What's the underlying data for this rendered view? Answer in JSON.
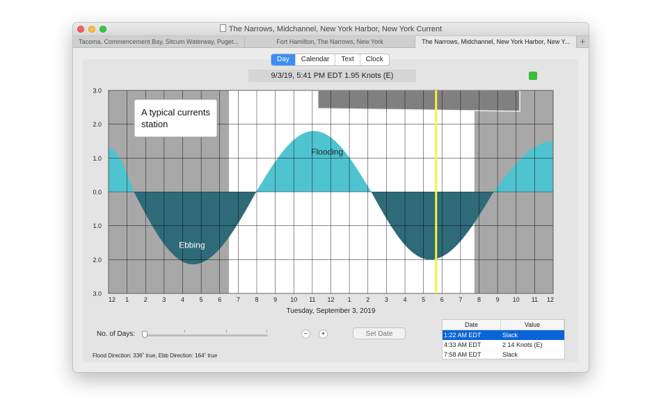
{
  "window": {
    "title": "The Narrows, Midchannel, New York Harbor, New York Current",
    "tabs": [
      {
        "label": "Tacoma, Commencement Bay, Sitcum Waterway, Puget..."
      },
      {
        "label": "Fort Hamilton, The Narrows, New York"
      },
      {
        "label": "The Narrows, Midchannel, New York Harbor, New Y..."
      }
    ],
    "add_tab_label": "+"
  },
  "view_modes": [
    "Day",
    "Calendar",
    "Text",
    "Clock"
  ],
  "selected_view": "Day",
  "readout": "9/3/19, 5:41 PM EDT 1.95 Knots (E)",
  "status_color": "#3bbf3b",
  "chart_data": {
    "type": "area",
    "x_tick_labels": [
      "12",
      "1",
      "2",
      "3",
      "4",
      "5",
      "6",
      "7",
      "8",
      "9",
      "10",
      "11",
      "12",
      "1",
      "2",
      "3",
      "4",
      "5",
      "6",
      "7",
      "8",
      "9",
      "10",
      "11",
      "12"
    ],
    "y_tick_labels": [
      "3.0",
      "2.0",
      "1.0",
      "0.0",
      "1.0",
      "2.0",
      "3.0"
    ],
    "ylim": [
      -3,
      3
    ],
    "xlim": [
      0,
      24
    ],
    "xlabel": "Tuesday, September 3, 2019",
    "series": [
      {
        "x": [
          0,
          1.37,
          4.55,
          7.97,
          11.08,
          14.18,
          17.35,
          20.78,
          24
        ],
        "y": [
          1.3,
          0,
          -2.14,
          0,
          1.8,
          0,
          -2.0,
          0,
          1.5
        ]
      }
    ],
    "annotations": {
      "flood_label": "Flooding",
      "ebb_label": "Ebbing",
      "callout": [
        "A typical currents",
        "station"
      ]
    },
    "current_time_hour": 17.68,
    "night_shading": [
      [
        0,
        6.5
      ],
      [
        19.75,
        24
      ]
    ],
    "flood_color": "#4fc3cf",
    "ebb_color": "#2e6a78",
    "marker_color": "#f5f538"
  },
  "controls": {
    "days_label": "No. of Days:",
    "minus_label": "−",
    "plus_label": "+",
    "set_date_label": "Set Date",
    "days_value": 1
  },
  "table": {
    "headers": [
      "Date",
      "Value"
    ],
    "rows": [
      {
        "date": "1:22 AM EDT",
        "value": "Slack",
        "selected": true
      },
      {
        "date": "4:33 AM EDT",
        "value": "2.14 Knots (E)",
        "selected": false
      },
      {
        "date": "7:58 AM EDT",
        "value": "Slack",
        "selected": false
      }
    ]
  },
  "footer": "Flood Direction: 336˚ true, Ebb Direction: 164˚ true"
}
